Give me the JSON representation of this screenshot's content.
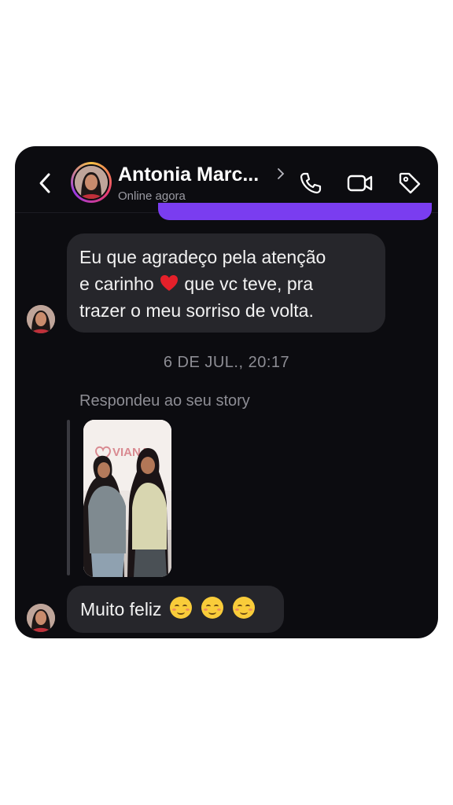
{
  "header": {
    "contact_name": "Antonia Marc...",
    "status": "Online agora",
    "icons": [
      "back-icon",
      "phone-icon",
      "video-icon",
      "tag-icon"
    ]
  },
  "messages": [
    {
      "id": "m1",
      "lines": [
        "Eu que agradeço pela atenção",
        "e carinho",
        "que vc teve, pra",
        "trazer o meu sorriso de volta."
      ],
      "emoji": "red-heart"
    },
    {
      "id": "m2",
      "text": "Muito feliz",
      "emoji": [
        "relieved-face",
        "relieved-face",
        "relieved-face"
      ]
    }
  ],
  "timestamp": "6 DE JUL., 20:17",
  "story_reply": {
    "label": "Respondeu ao seu story",
    "story_brand": "VIANA"
  },
  "colors": {
    "background": "#0c0c10",
    "bubble": "#26262b",
    "accent_purple": "#7a3df0"
  }
}
